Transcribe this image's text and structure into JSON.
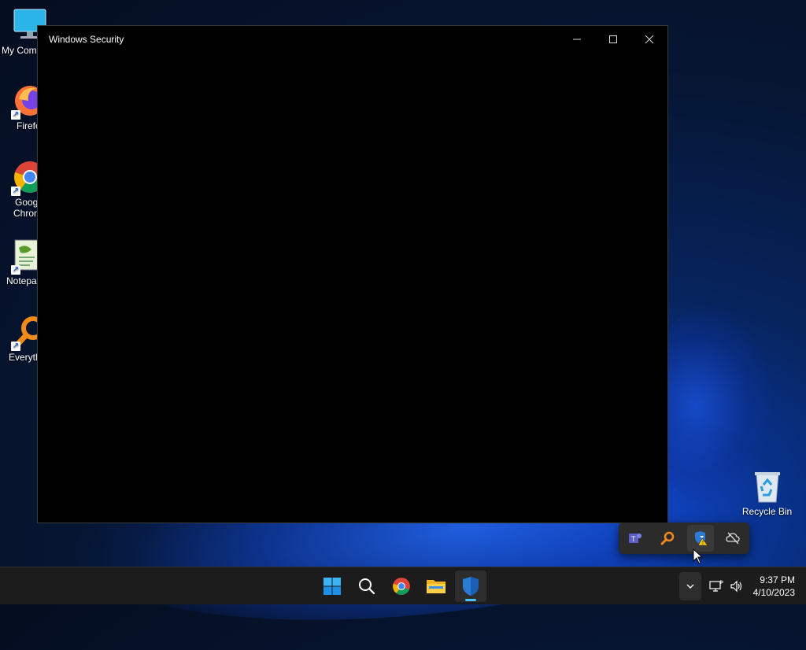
{
  "desktop": {
    "icons": [
      {
        "label": "My Com",
        "icon": "computer-icon"
      },
      {
        "label": "Firefo",
        "icon": "firefox-icon"
      },
      {
        "label": "Goog\nChron",
        "line1": "Goog",
        "line2": "Chron",
        "icon": "chrome-icon"
      },
      {
        "label": "Notepa",
        "icon": "notepad-icon"
      },
      {
        "label": "Everyth",
        "icon": "everything-icon"
      }
    ],
    "recycle_bin": {
      "label": "Recycle Bin",
      "icon": "recycle-bin-icon"
    }
  },
  "window": {
    "title": "Windows Security",
    "controls": [
      "minimize",
      "maximize",
      "close"
    ]
  },
  "tray_flyout": {
    "items": [
      "teams-icon",
      "everything-search-icon",
      "windows-security-warning-icon",
      "onedrive-offline-icon"
    ]
  },
  "taskbar": {
    "apps": [
      "start-icon",
      "search-icon",
      "chrome-icon",
      "file-explorer-icon",
      "windows-security-icon"
    ],
    "clock": {
      "time": "9:37 PM",
      "date": "4/10/2023"
    }
  },
  "colors": {
    "accent": "#4cc2ff",
    "taskbar": "#1c1c1c",
    "window_bg": "#000000"
  }
}
